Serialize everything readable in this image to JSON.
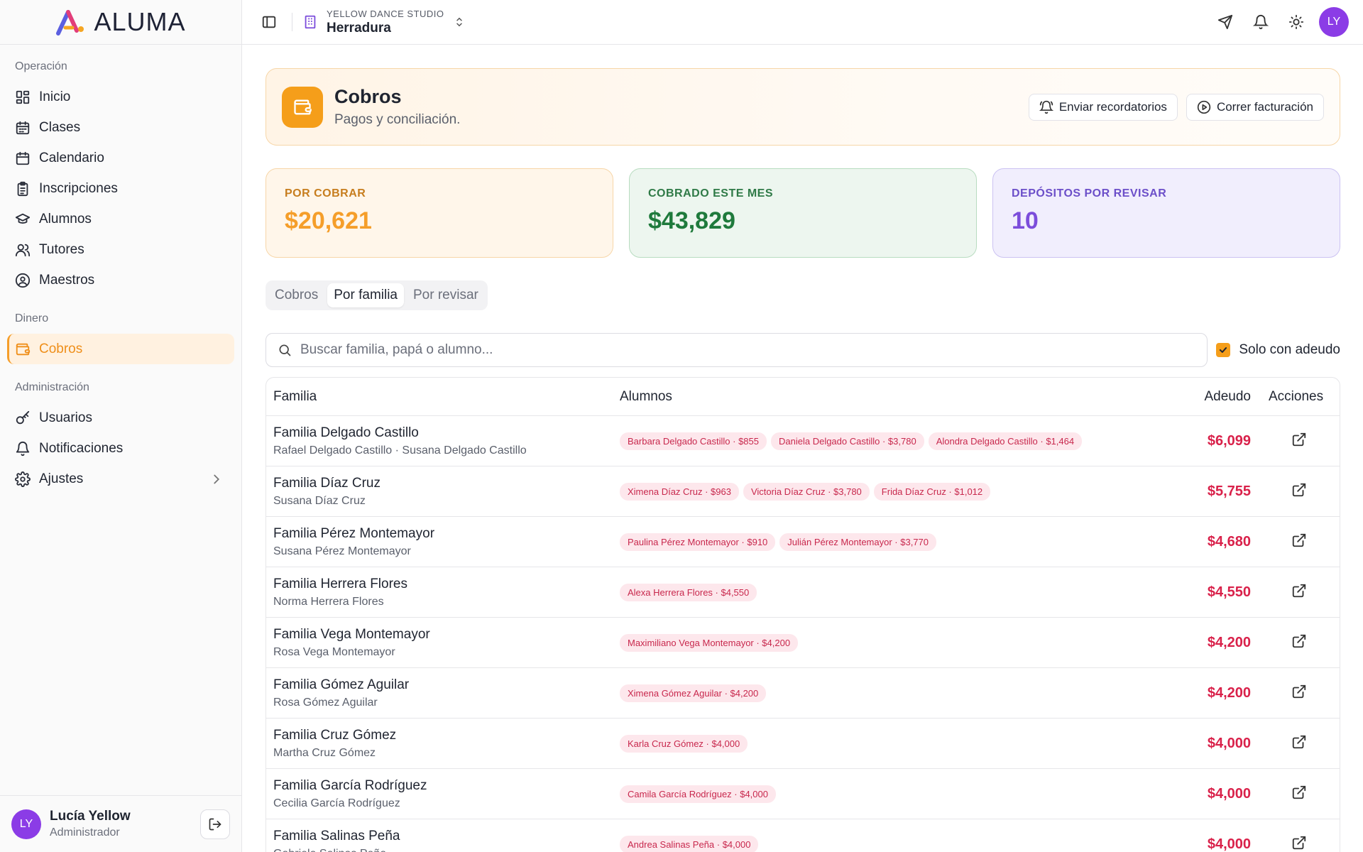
{
  "app": {
    "brand": "ALUMA"
  },
  "sidebar": {
    "sections": [
      {
        "label": "Operación",
        "items": [
          {
            "label": "Inicio",
            "icon": "dashboard-icon"
          },
          {
            "label": "Clases",
            "icon": "calendar-list-icon"
          },
          {
            "label": "Calendario",
            "icon": "calendar-icon"
          },
          {
            "label": "Inscripciones",
            "icon": "clipboard-icon"
          },
          {
            "label": "Alumnos",
            "icon": "graduation-cap-icon"
          },
          {
            "label": "Tutores",
            "icon": "users-icon"
          },
          {
            "label": "Maestros",
            "icon": "user-circle-icon"
          }
        ]
      },
      {
        "label": "Dinero",
        "items": [
          {
            "label": "Cobros",
            "icon": "wallet-icon",
            "active": true
          }
        ]
      },
      {
        "label": "Administración",
        "items": [
          {
            "label": "Usuarios",
            "icon": "key-icon"
          },
          {
            "label": "Notificaciones",
            "icon": "bell-icon"
          },
          {
            "label": "Ajustes",
            "icon": "gear-icon"
          }
        ]
      }
    ],
    "user": {
      "initials": "LY",
      "name": "Lucía Yellow",
      "role": "Administrador"
    }
  },
  "topbar": {
    "studio_kicker": "YELLOW DANCE STUDIO",
    "studio_name": "Herradura",
    "avatar_initials": "LY"
  },
  "header": {
    "title": "Cobros",
    "subtitle": "Pagos y conciliación.",
    "btn_reminders": "Enviar recordatorios",
    "btn_billing": "Correr facturación"
  },
  "stats": {
    "pending_label": "POR COBRAR",
    "pending_value": "$20,621",
    "collected_label": "COBRADO ESTE MES",
    "collected_value": "$43,829",
    "deposits_label": "DEPÓSITOS POR REVISAR",
    "deposits_value": "10"
  },
  "tabs": [
    {
      "label": "Cobros"
    },
    {
      "label": "Por familia",
      "active": true
    },
    {
      "label": "Por revisar"
    }
  ],
  "filters": {
    "search_placeholder": "Buscar familia, papá o alumno...",
    "only_due_label": "Solo con adeudo"
  },
  "table": {
    "headers": {
      "family": "Familia",
      "students": "Alumnos",
      "due": "Adeudo",
      "actions": "Acciones"
    },
    "rows": [
      {
        "family": "Familia Delgado Castillo",
        "parents": "Rafael Delgado Castillo · Susana Delgado Castillo",
        "students": [
          "Barbara Delgado Castillo · $855",
          "Daniela Delgado Castillo · $3,780",
          "Alondra Delgado Castillo · $1,464"
        ],
        "due": "$6,099"
      },
      {
        "family": "Familia Díaz Cruz",
        "parents": "Susana Díaz Cruz",
        "students": [
          "Ximena Díaz Cruz · $963",
          "Victoria Díaz Cruz · $3,780",
          "Frida Díaz Cruz · $1,012"
        ],
        "due": "$5,755"
      },
      {
        "family": "Familia Pérez Montemayor",
        "parents": "Susana Pérez Montemayor",
        "students": [
          "Paulina Pérez Montemayor · $910",
          "Julián Pérez Montemayor · $3,770"
        ],
        "due": "$4,680"
      },
      {
        "family": "Familia Herrera Flores",
        "parents": "Norma Herrera Flores",
        "students": [
          "Alexa Herrera Flores · $4,550"
        ],
        "due": "$4,550"
      },
      {
        "family": "Familia Vega Montemayor",
        "parents": "Rosa Vega Montemayor",
        "students": [
          "Maximiliano Vega Montemayor · $4,200"
        ],
        "due": "$4,200"
      },
      {
        "family": "Familia Gómez Aguilar",
        "parents": "Rosa Gómez Aguilar",
        "students": [
          "Ximena Gómez Aguilar · $4,200"
        ],
        "due": "$4,200"
      },
      {
        "family": "Familia Cruz Gómez",
        "parents": "Martha Cruz Gómez",
        "students": [
          "Karla Cruz Gómez · $4,000"
        ],
        "due": "$4,000"
      },
      {
        "family": "Familia García Rodríguez",
        "parents": "Cecilia García Rodríguez",
        "students": [
          "Camila García Rodríguez · $4,000"
        ],
        "due": "$4,000"
      },
      {
        "family": "Familia Salinas Peña",
        "parents": "Gabriela Salinas Peña",
        "students": [
          "Andrea Salinas Peña · $4,000"
        ],
        "due": "$4,000"
      }
    ]
  },
  "colors": {
    "accent": "#f59e1a",
    "danger": "#d9214a",
    "purple": "#8b3ce6"
  }
}
